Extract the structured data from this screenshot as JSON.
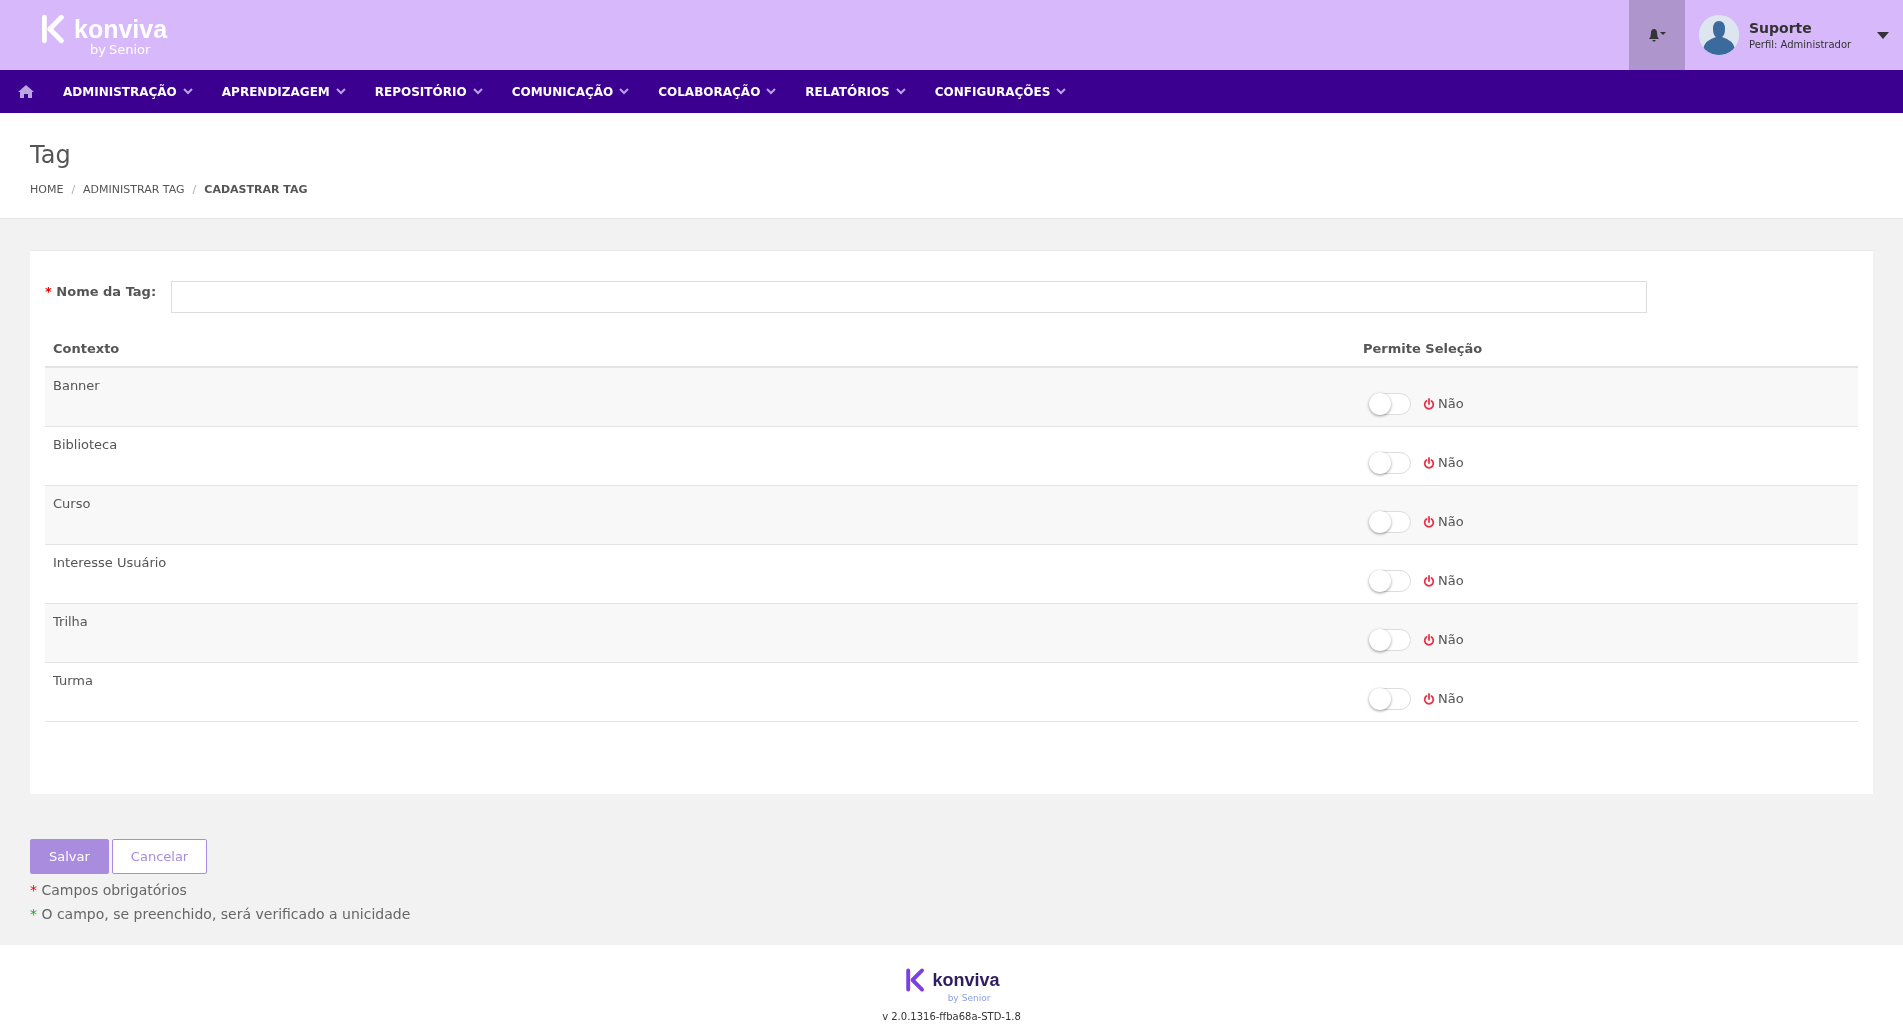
{
  "header": {
    "logo": {
      "name": "konviva",
      "by": "by",
      "brand": "Senior"
    },
    "user": {
      "name": "Suporte",
      "profile": "Perfil: Administrador"
    }
  },
  "nav": [
    {
      "label": "ADMINISTRAÇÃO"
    },
    {
      "label": "APRENDIZAGEM"
    },
    {
      "label": "REPOSITÓRIO"
    },
    {
      "label": "COMUNICAÇÃO"
    },
    {
      "label": "COLABORAÇÃO"
    },
    {
      "label": "RELATÓRIOS"
    },
    {
      "label": "CONFIGURAÇÕES"
    }
  ],
  "page": {
    "title": "Tag",
    "separator": "/",
    "breadcrumb": [
      {
        "label": "HOME",
        "current": false
      },
      {
        "label": "ADMINISTRAR TAG",
        "current": false
      },
      {
        "label": "CADASTRAR TAG",
        "current": true
      }
    ]
  },
  "form": {
    "field": {
      "mark": "*",
      "label": "Nome da Tag:"
    },
    "table": {
      "columns": [
        "Contexto",
        "Permite Seleção"
      ],
      "rows": [
        {
          "context": "Banner",
          "on": false,
          "state": "Não"
        },
        {
          "context": "Biblioteca",
          "on": false,
          "state": "Não"
        },
        {
          "context": "Curso",
          "on": false,
          "state": "Não"
        },
        {
          "context": "Interesse Usuário",
          "on": false,
          "state": "Não"
        },
        {
          "context": "Trilha",
          "on": false,
          "state": "Não"
        },
        {
          "context": "Turma",
          "on": false,
          "state": "Não"
        }
      ]
    }
  },
  "buttons": [
    {
      "label": "Salvar",
      "kind": "primary"
    },
    {
      "label": "Cancelar",
      "kind": "secondary"
    }
  ],
  "notes": [
    {
      "mark": "*",
      "kind": "required",
      "text": "Campos obrigatórios"
    },
    {
      "mark": "*",
      "kind": "unique",
      "text": "O campo, se preenchido, será verificado a unicidade"
    }
  ],
  "footer": {
    "logo": {
      "name": "konviva",
      "by": "by",
      "brand": "Senior"
    },
    "version": "v 2.0.1316-ffba68a-STD-1.8"
  }
}
